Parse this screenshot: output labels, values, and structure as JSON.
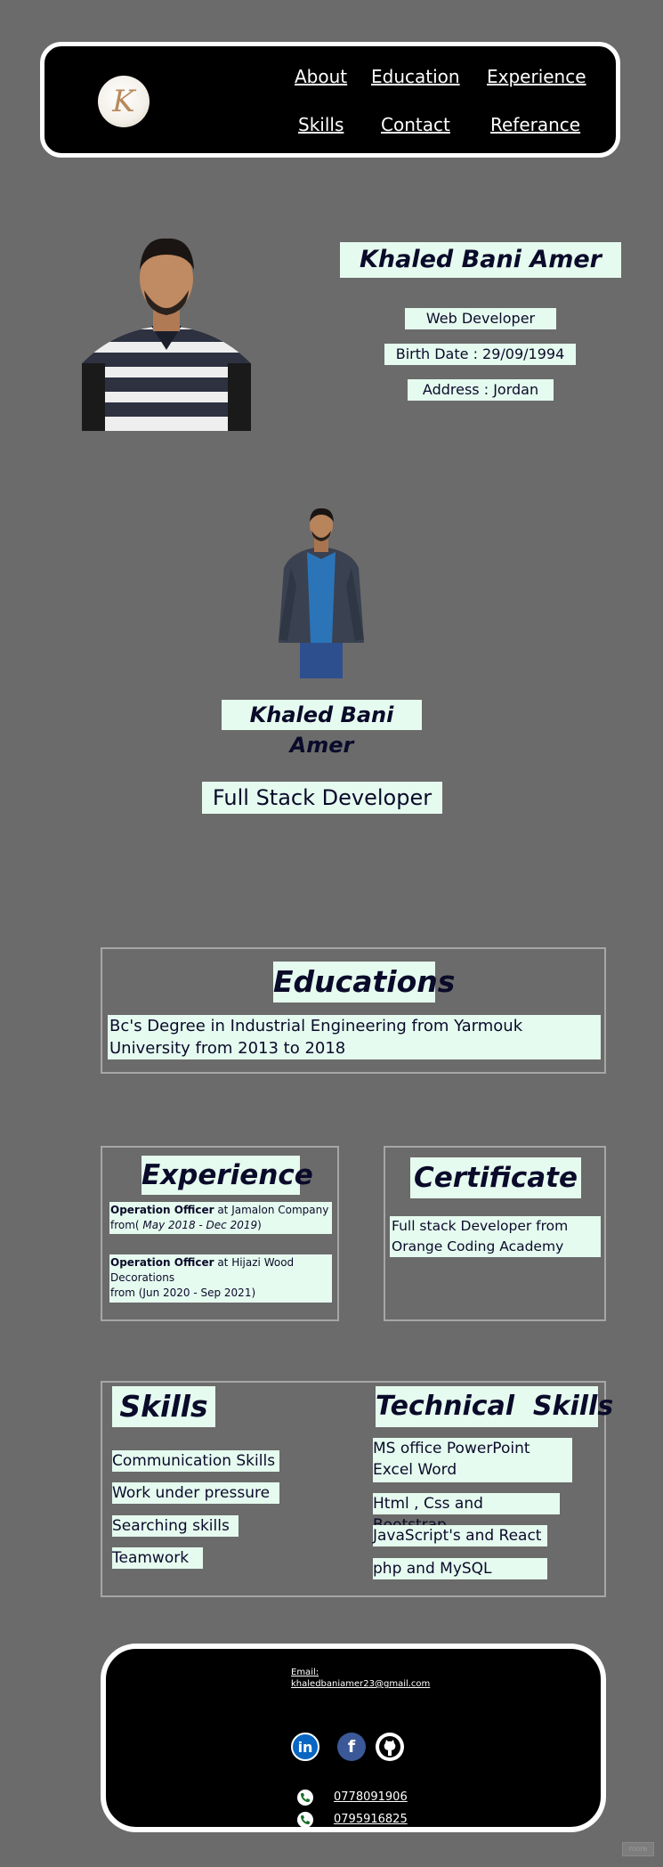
{
  "nav": {
    "logo_letter": "K",
    "links": [
      "About",
      "Education",
      "Experience",
      "Skills",
      "Contact",
      "Referance"
    ]
  },
  "profile": {
    "name": "Khaled Bani Amer",
    "role": "Web Developer",
    "birth": "Birth Date : 29/09/1994",
    "address": "Address : Jordan"
  },
  "hero": {
    "name": "Khaled Bani Amer",
    "title": "Full Stack Developer"
  },
  "education": {
    "heading": "Educations",
    "text": "Bc's Degree in Industrial Engineering from Yarmouk University from 2013 to 2018"
  },
  "experience": {
    "heading": "Experience",
    "jobs": [
      {
        "title": "Operation Officer",
        "company": " at Jamalon Company",
        "from_prefix": "from(",
        "dates": " May 2018 - Dec 2019",
        "from_suffix": ")"
      },
      {
        "title": "Operation Officer",
        "company": " at Hijazi Wood Decorations",
        "dates_plain": "from (Jun 2020 - Sep 2021)"
      }
    ]
  },
  "certificate": {
    "heading": "Certificate",
    "text": "Full stack Developer from Orange Coding Academy"
  },
  "skills": {
    "heading": "Skills",
    "items": [
      "Communication Skills",
      "Work under pressure",
      "Searching skills",
      "Teamwork"
    ]
  },
  "technical": {
    "heading": "Technical  Skills",
    "items": [
      "MS office PowerPoint Excel Word",
      "Html , Css and Bootstrap",
      "JavaScript's and React",
      "php and MySQL"
    ]
  },
  "footer": {
    "email_label": "Email:",
    "email": "khaledbaniamer23@gmail.com",
    "phones": [
      "0778091906",
      "0795916825"
    ],
    "social_icons": [
      "linkedin-icon",
      "facebook-icon",
      "github-icon"
    ],
    "linkedin_glyph": "in",
    "facebook_glyph": "f"
  },
  "corner_badge": "more",
  "colors": {
    "page_bg": "#6b6b6b",
    "box_bg": "#e6fbef",
    "text": "#0a0a2a",
    "linkedin": "#0a66c2",
    "facebook": "#3b5998"
  }
}
